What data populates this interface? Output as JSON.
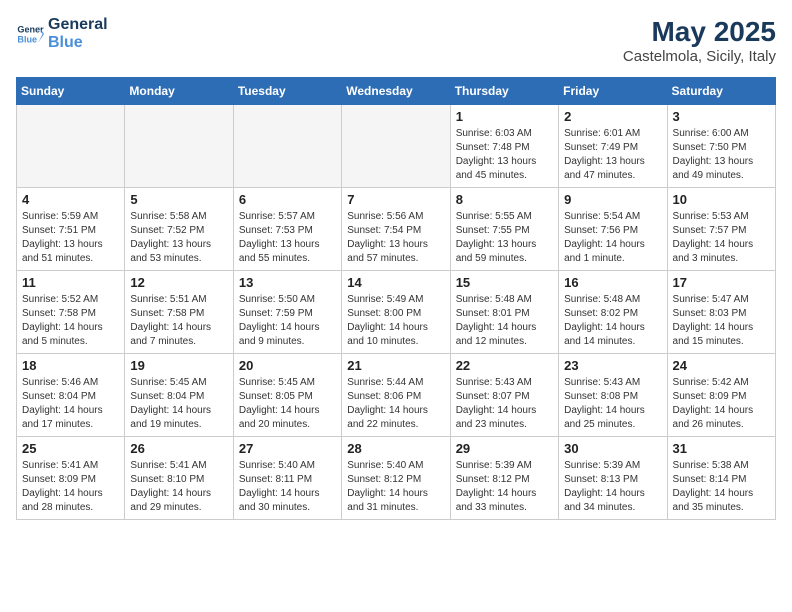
{
  "header": {
    "logo_line1": "General",
    "logo_line2": "Blue",
    "month": "May 2025",
    "location": "Castelmola, Sicily, Italy"
  },
  "weekdays": [
    "Sunday",
    "Monday",
    "Tuesday",
    "Wednesday",
    "Thursday",
    "Friday",
    "Saturday"
  ],
  "weeks": [
    [
      {
        "day": "",
        "info": ""
      },
      {
        "day": "",
        "info": ""
      },
      {
        "day": "",
        "info": ""
      },
      {
        "day": "",
        "info": ""
      },
      {
        "day": "1",
        "info": "Sunrise: 6:03 AM\nSunset: 7:48 PM\nDaylight: 13 hours\nand 45 minutes."
      },
      {
        "day": "2",
        "info": "Sunrise: 6:01 AM\nSunset: 7:49 PM\nDaylight: 13 hours\nand 47 minutes."
      },
      {
        "day": "3",
        "info": "Sunrise: 6:00 AM\nSunset: 7:50 PM\nDaylight: 13 hours\nand 49 minutes."
      }
    ],
    [
      {
        "day": "4",
        "info": "Sunrise: 5:59 AM\nSunset: 7:51 PM\nDaylight: 13 hours\nand 51 minutes."
      },
      {
        "day": "5",
        "info": "Sunrise: 5:58 AM\nSunset: 7:52 PM\nDaylight: 13 hours\nand 53 minutes."
      },
      {
        "day": "6",
        "info": "Sunrise: 5:57 AM\nSunset: 7:53 PM\nDaylight: 13 hours\nand 55 minutes."
      },
      {
        "day": "7",
        "info": "Sunrise: 5:56 AM\nSunset: 7:54 PM\nDaylight: 13 hours\nand 57 minutes."
      },
      {
        "day": "8",
        "info": "Sunrise: 5:55 AM\nSunset: 7:55 PM\nDaylight: 13 hours\nand 59 minutes."
      },
      {
        "day": "9",
        "info": "Sunrise: 5:54 AM\nSunset: 7:56 PM\nDaylight: 14 hours\nand 1 minute."
      },
      {
        "day": "10",
        "info": "Sunrise: 5:53 AM\nSunset: 7:57 PM\nDaylight: 14 hours\nand 3 minutes."
      }
    ],
    [
      {
        "day": "11",
        "info": "Sunrise: 5:52 AM\nSunset: 7:58 PM\nDaylight: 14 hours\nand 5 minutes."
      },
      {
        "day": "12",
        "info": "Sunrise: 5:51 AM\nSunset: 7:58 PM\nDaylight: 14 hours\nand 7 minutes."
      },
      {
        "day": "13",
        "info": "Sunrise: 5:50 AM\nSunset: 7:59 PM\nDaylight: 14 hours\nand 9 minutes."
      },
      {
        "day": "14",
        "info": "Sunrise: 5:49 AM\nSunset: 8:00 PM\nDaylight: 14 hours\nand 10 minutes."
      },
      {
        "day": "15",
        "info": "Sunrise: 5:48 AM\nSunset: 8:01 PM\nDaylight: 14 hours\nand 12 minutes."
      },
      {
        "day": "16",
        "info": "Sunrise: 5:48 AM\nSunset: 8:02 PM\nDaylight: 14 hours\nand 14 minutes."
      },
      {
        "day": "17",
        "info": "Sunrise: 5:47 AM\nSunset: 8:03 PM\nDaylight: 14 hours\nand 15 minutes."
      }
    ],
    [
      {
        "day": "18",
        "info": "Sunrise: 5:46 AM\nSunset: 8:04 PM\nDaylight: 14 hours\nand 17 minutes."
      },
      {
        "day": "19",
        "info": "Sunrise: 5:45 AM\nSunset: 8:04 PM\nDaylight: 14 hours\nand 19 minutes."
      },
      {
        "day": "20",
        "info": "Sunrise: 5:45 AM\nSunset: 8:05 PM\nDaylight: 14 hours\nand 20 minutes."
      },
      {
        "day": "21",
        "info": "Sunrise: 5:44 AM\nSunset: 8:06 PM\nDaylight: 14 hours\nand 22 minutes."
      },
      {
        "day": "22",
        "info": "Sunrise: 5:43 AM\nSunset: 8:07 PM\nDaylight: 14 hours\nand 23 minutes."
      },
      {
        "day": "23",
        "info": "Sunrise: 5:43 AM\nSunset: 8:08 PM\nDaylight: 14 hours\nand 25 minutes."
      },
      {
        "day": "24",
        "info": "Sunrise: 5:42 AM\nSunset: 8:09 PM\nDaylight: 14 hours\nand 26 minutes."
      }
    ],
    [
      {
        "day": "25",
        "info": "Sunrise: 5:41 AM\nSunset: 8:09 PM\nDaylight: 14 hours\nand 28 minutes."
      },
      {
        "day": "26",
        "info": "Sunrise: 5:41 AM\nSunset: 8:10 PM\nDaylight: 14 hours\nand 29 minutes."
      },
      {
        "day": "27",
        "info": "Sunrise: 5:40 AM\nSunset: 8:11 PM\nDaylight: 14 hours\nand 30 minutes."
      },
      {
        "day": "28",
        "info": "Sunrise: 5:40 AM\nSunset: 8:12 PM\nDaylight: 14 hours\nand 31 minutes."
      },
      {
        "day": "29",
        "info": "Sunrise: 5:39 AM\nSunset: 8:12 PM\nDaylight: 14 hours\nand 33 minutes."
      },
      {
        "day": "30",
        "info": "Sunrise: 5:39 AM\nSunset: 8:13 PM\nDaylight: 14 hours\nand 34 minutes."
      },
      {
        "day": "31",
        "info": "Sunrise: 5:38 AM\nSunset: 8:14 PM\nDaylight: 14 hours\nand 35 minutes."
      }
    ]
  ]
}
